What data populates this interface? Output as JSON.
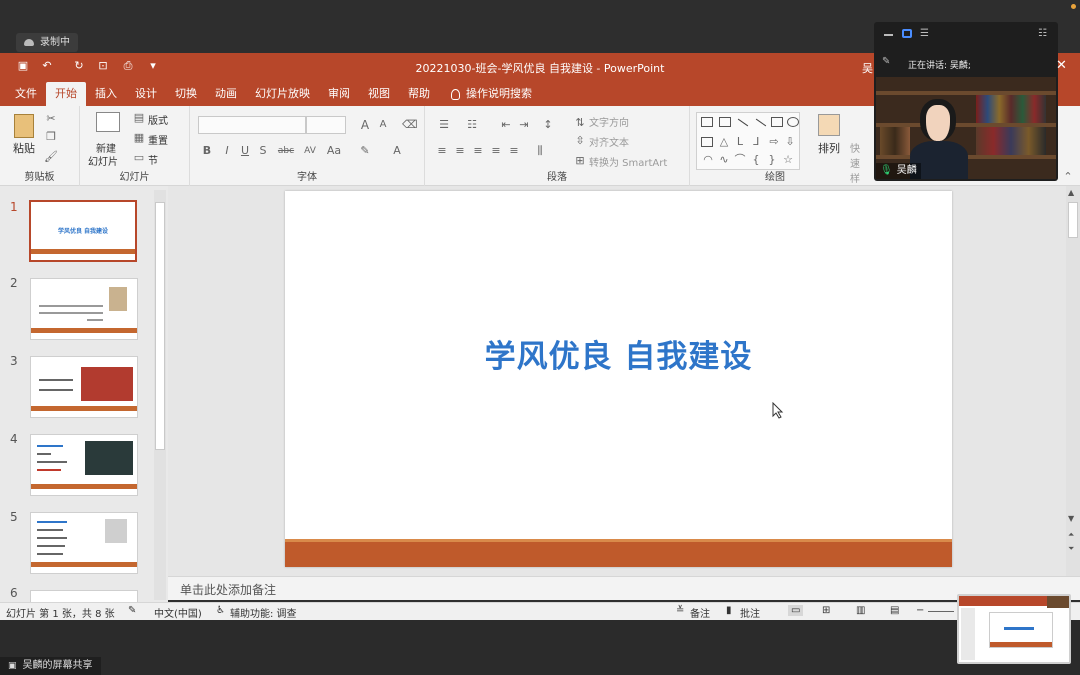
{
  "zoom": {
    "recording_label": "录制中",
    "speaking_label": "正在讲话: 吴麟;",
    "participant_name": "吴麟",
    "share_label": "吴麟的屏幕共享"
  },
  "window": {
    "title": "20221030-班会-学风优良 自我建设  -  PowerPoint",
    "user_initial": "吴"
  },
  "ribbon": {
    "tabs": [
      "文件",
      "开始",
      "插入",
      "设计",
      "切换",
      "动画",
      "幻灯片放映",
      "审阅",
      "视图",
      "帮助"
    ],
    "active_tab": "开始",
    "tell_me": "操作说明搜索",
    "clipboard": {
      "paste": "粘贴",
      "label": "剪贴板"
    },
    "slides": {
      "new_slide_1": "新建",
      "new_slide_2": "幻灯片",
      "layout": "版式",
      "reset": "重置",
      "section": "节",
      "label": "幻灯片"
    },
    "font": {
      "label": "字体",
      "buttons": [
        "B",
        "I",
        "U",
        "S",
        "abc",
        "AV",
        "Aa",
        "A"
      ]
    },
    "paragraph": {
      "label": "段落",
      "text_direction": "文字方向",
      "align_text": "对齐文本",
      "smartart": "转换为 SmartArt"
    },
    "drawing": {
      "label": "绘图",
      "arrange": "排列",
      "quick_styles": "快速样"
    }
  },
  "thumbnails": [
    {
      "num": "1",
      "title": "学风优良 自我建设"
    },
    {
      "num": "2"
    },
    {
      "num": "3"
    },
    {
      "num": "4"
    },
    {
      "num": "5"
    },
    {
      "num": "6"
    }
  ],
  "slide": {
    "title": "学风优良 自我建设"
  },
  "notes_placeholder": "单击此处添加备注",
  "status": {
    "slide_pos": "幻灯片 第 1 张，共 8 张",
    "language": "中文(中国)",
    "accessibility": "辅助功能: 调查",
    "notes": "备注",
    "comments": "批注"
  },
  "colors": {
    "ppt_accent": "#b7472a",
    "title_blue": "#2e75c9",
    "footer_orange": "#bf5a2b"
  }
}
